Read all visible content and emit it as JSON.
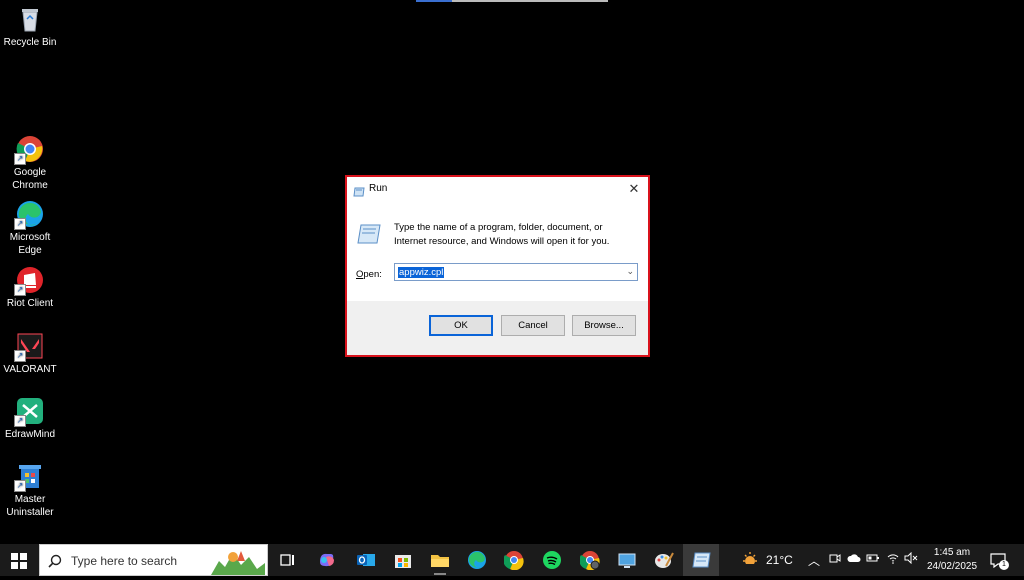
{
  "desktop": {
    "icons": [
      {
        "label": "Recycle Bin"
      },
      {
        "label": "Google\nChrome"
      },
      {
        "label": "Microsoft\nEdge"
      },
      {
        "label": "Riot Client"
      },
      {
        "label": "VALORANT"
      },
      {
        "label": "EdrawMind"
      },
      {
        "label": "Master\nUninstaller"
      }
    ]
  },
  "run_dialog": {
    "title": "Run",
    "description": "Type the name of a program, folder, document, or Internet resource, and Windows will open it for you.",
    "open_label_prefix": "",
    "open_label_underlined": "O",
    "open_label_rest": "pen:",
    "input_value": "appwiz.cpl",
    "ok_label": "OK",
    "cancel_label": "Cancel",
    "browse_label": "Browse..."
  },
  "taskbar": {
    "search_placeholder": "Type here to search",
    "weather_temp": "21°C",
    "time": "1:45 am",
    "date": "24/02/2025",
    "notification_count": "1"
  },
  "colors": {
    "highlight_border": "#d9121c",
    "selection": "#0a64d8",
    "taskbar_bg": "#1b1b1b"
  }
}
